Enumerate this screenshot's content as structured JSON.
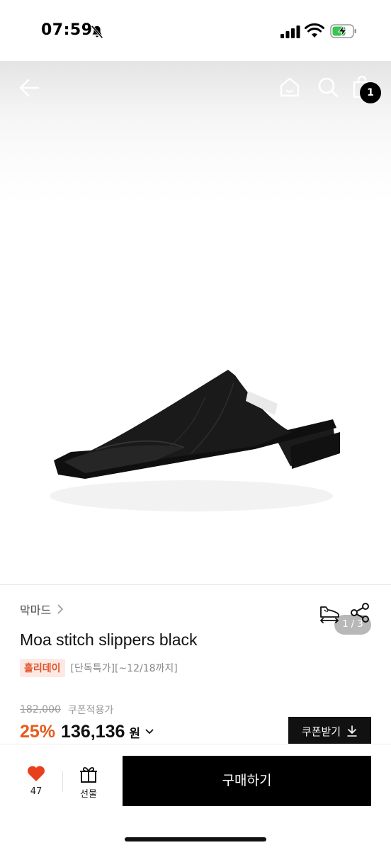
{
  "status_bar": {
    "time": "07:59"
  },
  "nav": {
    "cart_count": "1"
  },
  "gallery": {
    "page_indicator": "1 / 3"
  },
  "product": {
    "brand": "막마드",
    "title": "Moa stitch slippers black",
    "promo_badge": "홀리데이",
    "promo_text": "[단독특가][~12/18까지]",
    "original_price": "182,000",
    "coupon_note": "쿠폰적용가",
    "discount": "25%",
    "sale_price": "136,136",
    "currency": "원",
    "coupon_button_label": "쿠폰받기"
  },
  "bottom_bar": {
    "like_count": "47",
    "gift_label": "선물",
    "buy_label": "구매하기"
  },
  "colors": {
    "accent_orange": "#e85a1c",
    "heart_red": "#e8401c",
    "promo_bg": "#fde9e4",
    "button_black": "#000000"
  }
}
